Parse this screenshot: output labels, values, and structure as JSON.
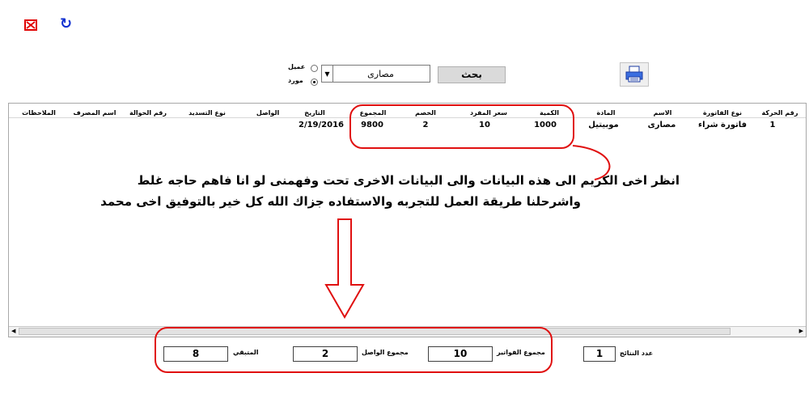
{
  "toolbar": {
    "close_icon": "close-x-icon",
    "refresh_icon": "refresh-icon",
    "refresh_glyph": "↻"
  },
  "search": {
    "option_customer": "عميل",
    "option_supplier": "مورد",
    "selected_option": "مورد",
    "selected_value": "مصارى",
    "button_label": "بحث",
    "print_icon": "printer-icon"
  },
  "table": {
    "columns": [
      {
        "key": "txn_no",
        "label": "رقم الحركة"
      },
      {
        "key": "invoice_type",
        "label": "نوع الفاتورة"
      },
      {
        "key": "name",
        "label": "الاسم"
      },
      {
        "key": "item",
        "label": "المادة"
      },
      {
        "key": "qty",
        "label": "الكمية"
      },
      {
        "key": "unit_price",
        "label": "سعر المفرد"
      },
      {
        "key": "discount",
        "label": "الخصم"
      },
      {
        "key": "total",
        "label": "المجموع"
      },
      {
        "key": "date",
        "label": "التاريخ"
      },
      {
        "key": "received",
        "label": "الواصل"
      },
      {
        "key": "payment_type",
        "label": "نوع التسديد"
      },
      {
        "key": "transfer_no",
        "label": "رقم الحوالة"
      },
      {
        "key": "bank_name",
        "label": "اسم المصرف"
      },
      {
        "key": "notes",
        "label": "الملاحظات"
      }
    ],
    "rows": [
      {
        "txn_no": "1",
        "invoice_type": "فاتورة شراء",
        "name": "مصارى",
        "item": "موبيتيل",
        "qty": "1000",
        "unit_price": "10",
        "discount": "2",
        "total": "9800",
        "date": "2/19/2016",
        "received": "",
        "payment_type": "",
        "transfer_no": "",
        "bank_name": "",
        "notes": ""
      }
    ]
  },
  "annotation": {
    "line1": "انظر اخى الكريم الى هذه البيانات والى البيانات الاخرى تحت وفهمنى لو انا فاهم حاجه غلط",
    "line2": "واشرحلنا طريقة العمل للتجربه والاستفاده جزاك الله كل خير بالتوفيق اخى محمد"
  },
  "summary": {
    "results_count_label": "عدد النتائج",
    "results_count": "1",
    "invoices_total_label": "مجموع الفواتير",
    "invoices_total": "10",
    "received_total_label": "مجموع الواصل",
    "received_total": "2",
    "remaining_label": "المتبقي",
    "remaining": "8"
  },
  "colors": {
    "highlight": "#e01010",
    "refresh": "#1030d0"
  }
}
